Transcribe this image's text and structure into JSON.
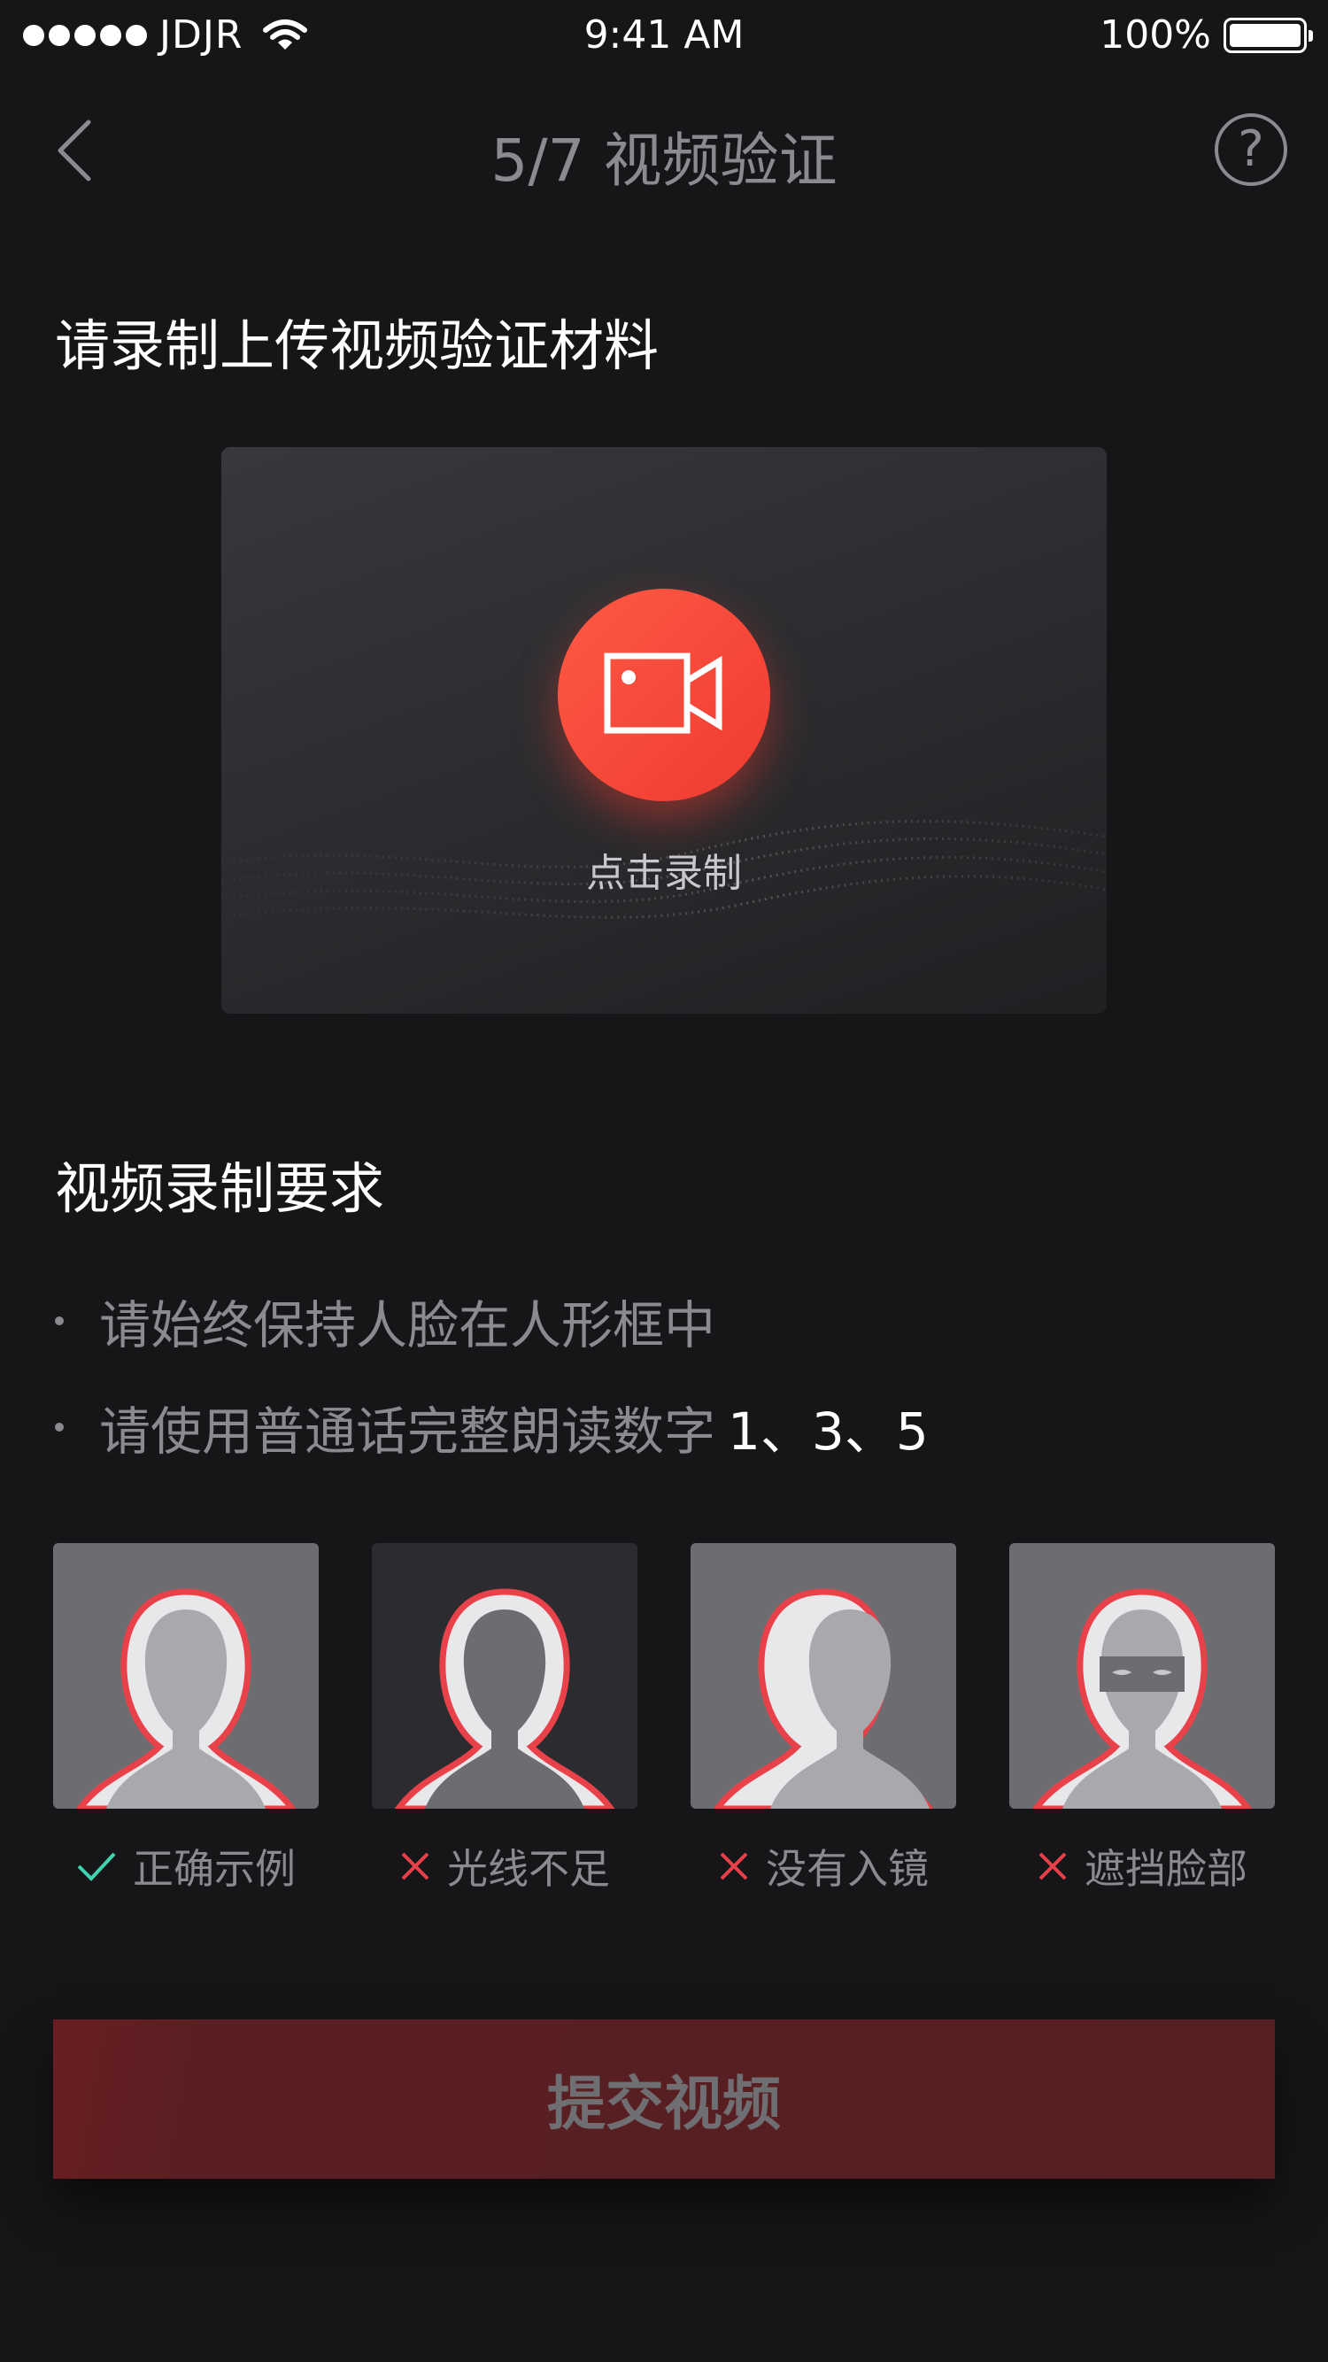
{
  "status_bar": {
    "carrier": "JDJR",
    "time": "9:41 AM",
    "battery": "100%"
  },
  "nav": {
    "title": "5/7 视频验证",
    "help": "?"
  },
  "upload_section": {
    "title": "请录制上传视频验证材料",
    "record_label": "点击录制"
  },
  "requirements": {
    "title": "视频录制要求",
    "items": [
      {
        "text": "请始终保持人脸在人形框中",
        "highlight": ""
      },
      {
        "text": "请使用普通话完整朗读数字",
        "highlight": "1、3、5"
      }
    ]
  },
  "examples": [
    {
      "label": "正确示例",
      "status": "correct",
      "icon": "check-icon"
    },
    {
      "label": "光线不足",
      "status": "wrong",
      "icon": "cross-icon"
    },
    {
      "label": "没有入镜",
      "status": "wrong",
      "icon": "cross-icon"
    },
    {
      "label": "遮挡脸部",
      "status": "wrong",
      "icon": "cross-icon"
    }
  ],
  "colors": {
    "accent": "#f0463a",
    "correct": "#3fd3b0",
    "wrong": "#e8414a",
    "muted": "#8b8b8f"
  },
  "submit": {
    "label": "提交视频"
  }
}
